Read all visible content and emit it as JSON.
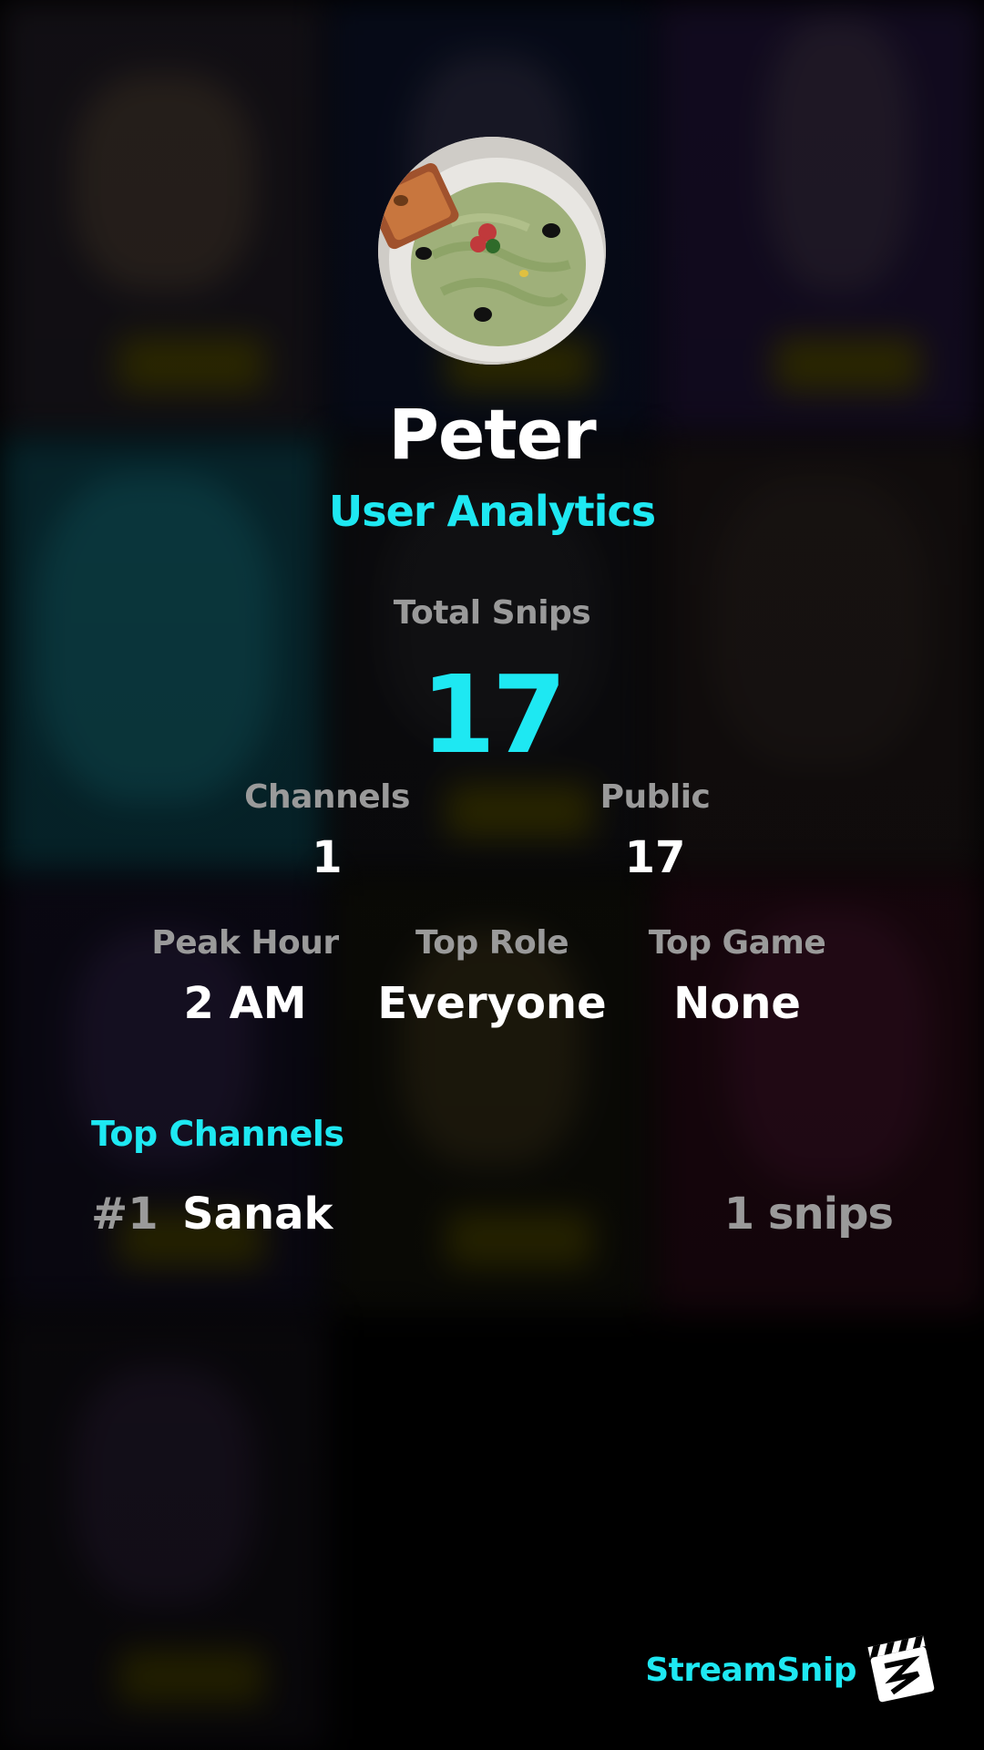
{
  "profile": {
    "username": "Peter",
    "subtitle": "User Analytics",
    "avatar": "user-avatar-image"
  },
  "stats": {
    "total_snips": {
      "label": "Total Snips",
      "value": "17"
    },
    "channels": {
      "label": "Channels",
      "value": "1"
    },
    "public": {
      "label": "Public",
      "value": "17"
    },
    "peak_hour": {
      "label": "Peak Hour",
      "value": "2 AM"
    },
    "top_role": {
      "label": "Top Role",
      "value": "Everyone"
    },
    "top_game": {
      "label": "Top Game",
      "value": "None"
    }
  },
  "top_channels": {
    "heading": "Top Channels",
    "items": [
      {
        "rank": "#1",
        "name": "Sanak",
        "count": "1 snips"
      }
    ]
  },
  "brand": {
    "name": "StreamSnip",
    "logo": "clapperboard-icon"
  },
  "colors": {
    "accent": "#1ee8f2",
    "muted": "#9a9a9a",
    "text": "#ffffff",
    "background": "#000000"
  }
}
